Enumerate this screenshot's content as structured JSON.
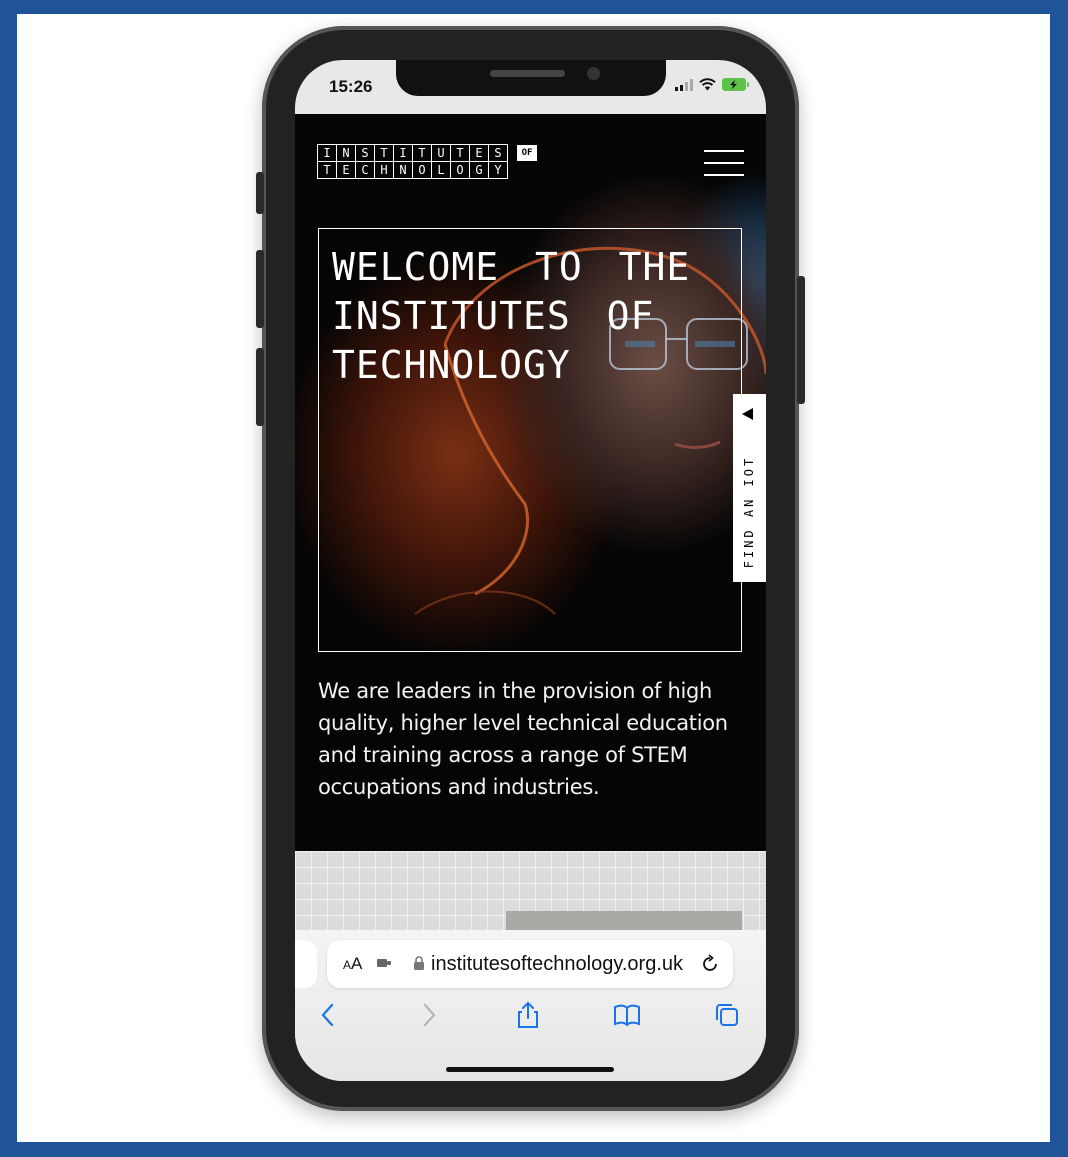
{
  "status_bar": {
    "time": "15:26"
  },
  "site": {
    "logo": {
      "row1": [
        "I",
        "N",
        "S",
        "T",
        "I",
        "T",
        "U",
        "T",
        "E",
        "S"
      ],
      "row2": [
        "T",
        "E",
        "C",
        "H",
        "N",
        "O",
        "L",
        "O",
        "G",
        "Y"
      ],
      "of": "OF"
    },
    "hero_title": "WELCOME TO THE INSTITUTES OF TECHNOLOGY",
    "find_iot": "FIND AN IOT",
    "hero_text": "We are leaders in the provision of high quality, higher level technical education and training across a range of STEM occupations and industries."
  },
  "browser": {
    "aa": "AA",
    "url": "institutesoftechnology.org.uk",
    "toolbar": [
      "back-icon",
      "forward-icon",
      "share-icon",
      "bookmarks-icon",
      "tabs-icon"
    ]
  },
  "colors": {
    "frame": "#1f5499",
    "accent_blue": "#1a73e8",
    "battery": "#5cc24a"
  }
}
